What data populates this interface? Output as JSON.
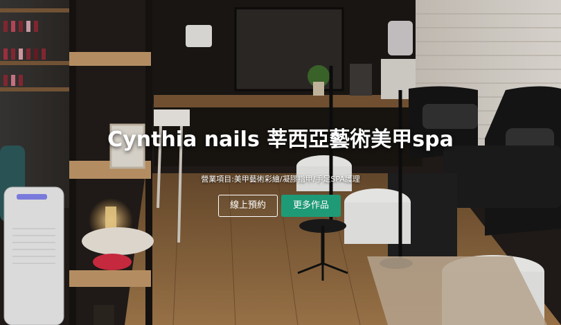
{
  "hero": {
    "title": "Cynthia nails 莘西亞藝術美甲spa",
    "subtitle": "營業項目:美甲藝術彩繪/凝膠指甲/手足SPA護理",
    "buttons": {
      "book_label": "線上預約",
      "more_label": "更多作品"
    },
    "colors": {
      "primary_button": "#1f9a76",
      "text": "#ffffff"
    }
  }
}
